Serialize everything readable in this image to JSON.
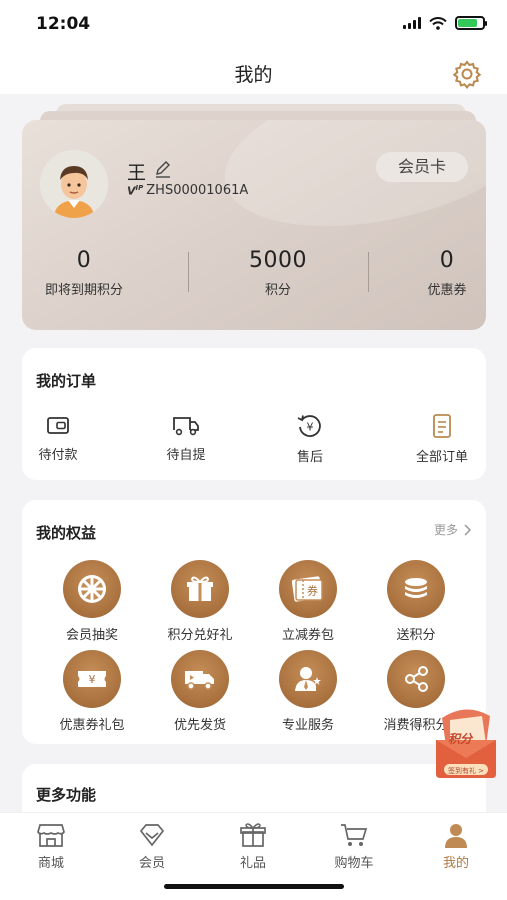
{
  "status_bar": {
    "time": "12:04"
  },
  "header": {
    "title": "我的"
  },
  "member_card": {
    "name": "王",
    "member_id": "ZHS00001061A",
    "card_button": "会员卡",
    "stats": [
      {
        "value": "0",
        "label": "即将到期积分"
      },
      {
        "value": "5000",
        "label": "积分"
      },
      {
        "value": "0",
        "label": "优惠券"
      }
    ]
  },
  "orders": {
    "title": "我的订单",
    "items": [
      {
        "label": "待付款",
        "icon": "wallet-icon"
      },
      {
        "label": "待自提",
        "icon": "truck-icon"
      },
      {
        "label": "售后",
        "icon": "after-sale-icon"
      },
      {
        "label": "全部订单",
        "icon": "document-icon"
      }
    ]
  },
  "benefits": {
    "title": "我的权益",
    "more": "更多",
    "items": [
      {
        "label": "会员抽奖",
        "icon": "lottery-wheel-icon"
      },
      {
        "label": "积分兑好礼",
        "icon": "gift-icon"
      },
      {
        "label": "立减券包",
        "icon": "coupon-icon"
      },
      {
        "label": "送积分",
        "icon": "coins-icon"
      },
      {
        "label": "优惠券礼包",
        "icon": "coupon-pack-icon"
      },
      {
        "label": "优先发货",
        "icon": "delivery-truck-icon"
      },
      {
        "label": "专业服务",
        "icon": "service-person-icon"
      },
      {
        "label": "消费得积分",
        "icon": "share-icon"
      }
    ]
  },
  "more_functions": {
    "title": "更多功能"
  },
  "floating_badge": {
    "title": "积分",
    "subtitle": "签到有礼 >"
  },
  "tabbar": {
    "items": [
      {
        "label": "商城",
        "icon": "store-icon"
      },
      {
        "label": "会员",
        "icon": "diamond-icon"
      },
      {
        "label": "礼品",
        "icon": "gift-box-icon"
      },
      {
        "label": "购物车",
        "icon": "cart-icon"
      },
      {
        "label": "我的",
        "icon": "person-icon"
      }
    ],
    "active_index": 4
  },
  "colors": {
    "accent": "#b07a45",
    "icon_brown": "#a8703d",
    "card_bg": "#ddd2cb"
  }
}
